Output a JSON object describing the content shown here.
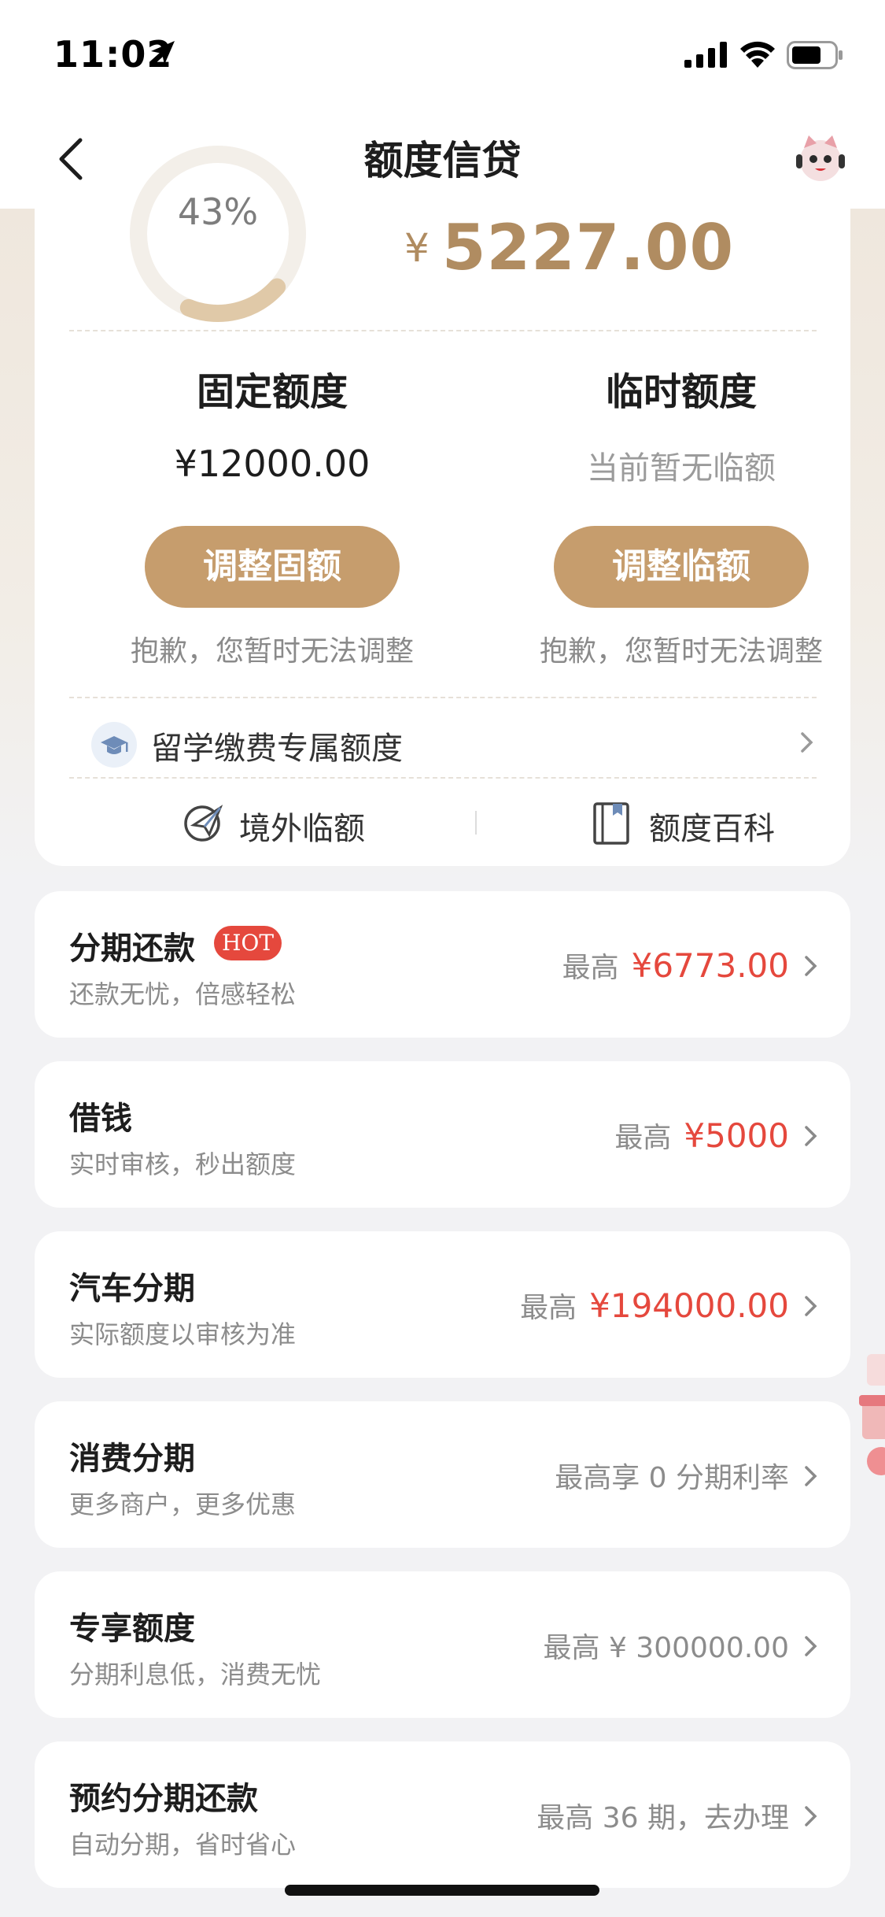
{
  "status": {
    "time": "11:02"
  },
  "nav": {
    "title": "额度信贷"
  },
  "summary": {
    "percent": "43%",
    "currency": "¥",
    "amount": "5227.00",
    "ring_fill_fraction": 0.43
  },
  "fixed": {
    "title": "固定额度",
    "value": "¥12000.00",
    "button": "调整固额",
    "note": "抱歉，您暂时无法调整"
  },
  "temp": {
    "title": "临时额度",
    "value": "当前暂无临额",
    "button": "调整临额",
    "note": "抱歉，您暂时无法调整"
  },
  "study": {
    "label": "留学缴费专属额度"
  },
  "links": {
    "overseas": "境外临额",
    "wiki": "额度百科"
  },
  "cards": [
    {
      "title": "分期还款",
      "badge": "HOT",
      "subtitle": "还款无忧，倍感轻松",
      "right_prefix": "最高",
      "right_value": "¥6773.00"
    },
    {
      "title": "借钱",
      "subtitle": "实时审核，秒出额度",
      "right_prefix": "最高",
      "right_value": "¥5000"
    },
    {
      "title": "汽车分期",
      "subtitle": "实际额度以审核为准",
      "right_prefix": "最高",
      "right_value": "¥194000.00"
    },
    {
      "title": "消费分期",
      "subtitle": "更多商户，更多优惠",
      "right_text": "最高享 0 分期利率"
    },
    {
      "title": "专享额度",
      "subtitle": "分期利息低，消费无忧",
      "right_text": "最高 ¥ 300000.00"
    },
    {
      "title": "预约分期还款",
      "subtitle": "自动分期，省时省心",
      "right_text": "最高 36 期，去办理"
    }
  ],
  "colors": {
    "accent": "#c69d6d",
    "amount": "#b08c61",
    "red": "#e5483d"
  }
}
